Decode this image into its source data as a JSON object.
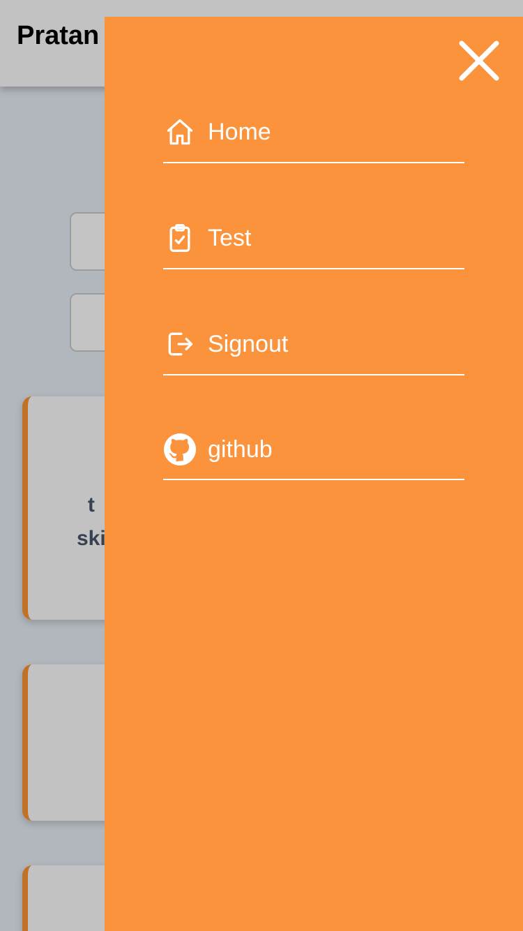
{
  "header": {
    "brand": "Pratan"
  },
  "card": {
    "text_fragment": "t\nski"
  },
  "drawer": {
    "items": [
      {
        "label": "Home",
        "icon": "home-icon"
      },
      {
        "label": "Test",
        "icon": "clipboard-check-icon"
      },
      {
        "label": "Signout",
        "icon": "logout-icon"
      },
      {
        "label": "github",
        "icon": "github-icon"
      }
    ]
  },
  "colors": {
    "drawer_bg": "#fb933c",
    "accent": "#c27228",
    "overlay_bg": "#b2b6bd",
    "text_on_drawer": "#ffffff"
  }
}
